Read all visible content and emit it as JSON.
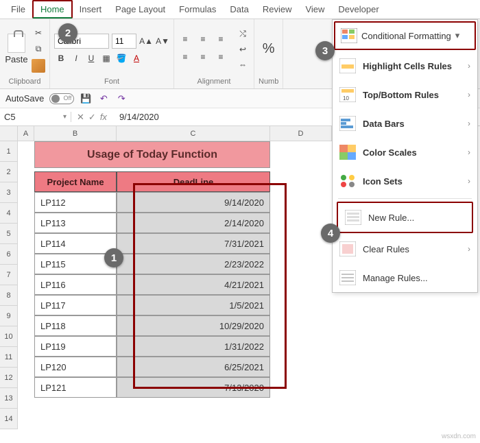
{
  "tabs": [
    "File",
    "Home",
    "Insert",
    "Page Layout",
    "Formulas",
    "Data",
    "Review",
    "View",
    "Developer"
  ],
  "active_tab": "Home",
  "clipboard": {
    "paste_label": "Paste",
    "group_label": "Clipboard"
  },
  "font": {
    "name": "Calibri",
    "size": "11",
    "group_label": "Font",
    "bold": "B",
    "italic": "I",
    "underline": "U"
  },
  "alignment": {
    "group_label": "Alignment"
  },
  "number": {
    "group_label": "Numb",
    "pct": "%"
  },
  "cond_fmt": {
    "title": "Conditional Formatting",
    "items": [
      {
        "label": "Highlight Cells Rules",
        "sub": true
      },
      {
        "label": "Top/Bottom Rules",
        "sub": true
      },
      {
        "label": "Data Bars",
        "sub": true
      },
      {
        "label": "Color Scales",
        "sub": true
      },
      {
        "label": "Icon Sets",
        "sub": true
      }
    ],
    "new_rule": "New Rule...",
    "clear_rules": "Clear Rules",
    "manage_rules": "Manage Rules..."
  },
  "qat": {
    "autosave": "AutoSave",
    "off": "Off"
  },
  "fbar": {
    "cell": "C5",
    "fx": "fx",
    "value": "9/14/2020"
  },
  "sheet": {
    "cols": [
      "A",
      "B",
      "C",
      "D"
    ],
    "rows": [
      "1",
      "2",
      "3",
      "4",
      "5",
      "6",
      "7",
      "8",
      "9",
      "10",
      "11",
      "12",
      "13",
      "14"
    ],
    "title": "Usage of Today Function",
    "hdr_project": "Project Name",
    "hdr_deadline": "DeadLine",
    "data": [
      {
        "p": "LP112",
        "d": "9/14/2020"
      },
      {
        "p": "LP113",
        "d": "2/14/2020"
      },
      {
        "p": "LP114",
        "d": "7/31/2021"
      },
      {
        "p": "LP115",
        "d": "2/23/2022"
      },
      {
        "p": "LP116",
        "d": "4/21/2021"
      },
      {
        "p": "LP117",
        "d": "1/5/2021"
      },
      {
        "p": "LP118",
        "d": "10/29/2020"
      },
      {
        "p": "LP119",
        "d": "1/31/2022"
      },
      {
        "p": "LP120",
        "d": "6/25/2021"
      },
      {
        "p": "LP121",
        "d": "7/13/2020"
      }
    ]
  },
  "badges": {
    "1": "1",
    "2": "2",
    "3": "3",
    "4": "4"
  },
  "watermark": "wsxdn.com"
}
